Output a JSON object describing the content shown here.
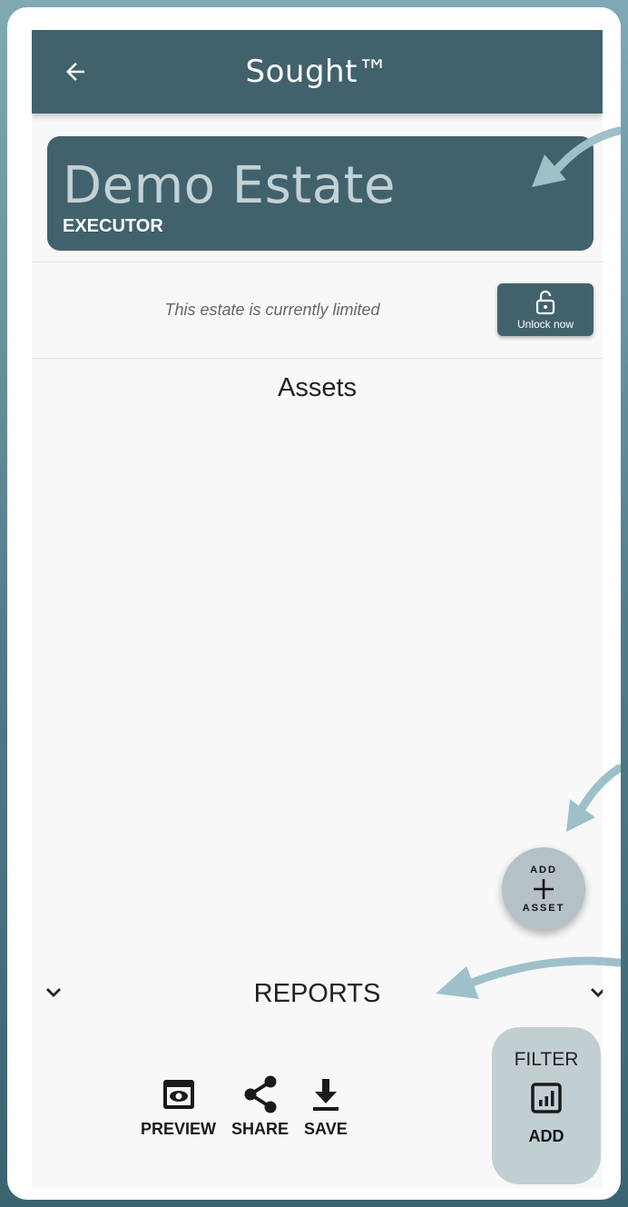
{
  "app": {
    "title": "Sought™"
  },
  "estate": {
    "name": "Demo Estate",
    "role": "EXECUTOR"
  },
  "banner": {
    "message": "This estate is currently limited",
    "unlock_label": "Unlock now"
  },
  "assets": {
    "title": "Assets"
  },
  "fab": {
    "top_label": "ADD",
    "bottom_label": "ASSET"
  },
  "reports": {
    "title": "REPORTS",
    "actions": [
      {
        "label": "PREVIEW",
        "icon": "preview-icon"
      },
      {
        "label": "SHARE",
        "icon": "share-icon"
      },
      {
        "label": "SAVE",
        "icon": "download-icon"
      }
    ]
  },
  "filter": {
    "label": "FILTER",
    "add_label": "ADD",
    "icon": "chart-box-icon"
  },
  "colors": {
    "appbar": "#41626c",
    "estate_name": "#c3d1d5",
    "fab": "#b4c1c6",
    "filter_panel": "#c2cfd2",
    "annotation_arrow": "#9ec0c9"
  }
}
